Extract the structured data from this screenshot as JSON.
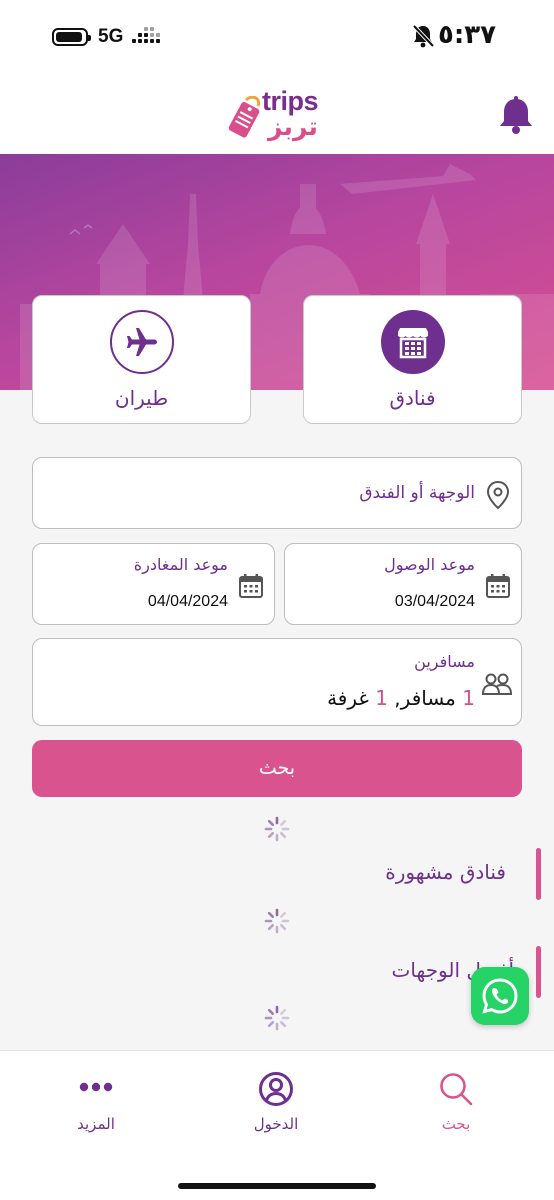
{
  "status_bar": {
    "network": "5G",
    "time": "٥:٣٧"
  },
  "header": {
    "logo_en": "trips",
    "logo_ar": "تربز"
  },
  "categories": [
    {
      "label": "فنادق",
      "icon": "hotel-icon",
      "selected": true
    },
    {
      "label": "طيران",
      "icon": "plane-icon",
      "selected": false
    }
  ],
  "form": {
    "destination_placeholder": "الوجهة أو الفندق",
    "arrival": {
      "label": "موعد الوصول",
      "value": "03/04/2024"
    },
    "departure": {
      "label": "موعد المغادرة",
      "value": "04/04/2024"
    },
    "travelers": {
      "label": "مسافرين",
      "traveler_count": "1",
      "traveler_word": "مسافر,",
      "room_count": "1",
      "room_word": "غرفة"
    },
    "search_label": "بحث"
  },
  "sections": [
    {
      "title": "فنادق مشهورة"
    },
    {
      "title": "أفضل الوجهات"
    }
  ],
  "bottom_nav": [
    {
      "label": "بحث",
      "icon": "search-icon",
      "active": true
    },
    {
      "label": "الدخول",
      "icon": "user-icon",
      "active": false
    },
    {
      "label": "المزيد",
      "icon": "more-icon",
      "active": false
    }
  ],
  "colors": {
    "primary": "#6e2f8e",
    "accent": "#d9548f",
    "whatsapp": "#25d366"
  }
}
